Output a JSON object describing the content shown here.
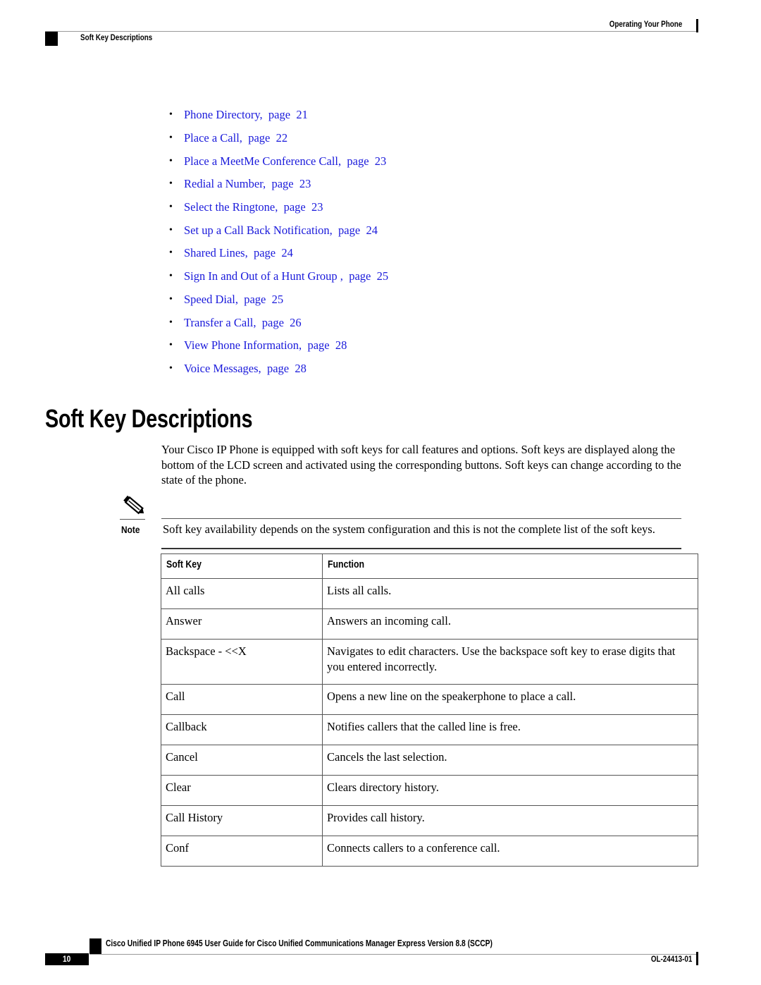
{
  "header": {
    "chapter": "Operating Your Phone",
    "section": "Soft Key Descriptions"
  },
  "toc": [
    {
      "title": "Phone Directory,",
      "page_label": "page",
      "page": "21"
    },
    {
      "title": "Place a Call,",
      "page_label": "page",
      "page": "22"
    },
    {
      "title": "Place a MeetMe Conference Call,",
      "page_label": "page",
      "page": "23"
    },
    {
      "title": "Redial a Number,",
      "page_label": "page",
      "page": "23"
    },
    {
      "title": "Select the Ringtone,",
      "page_label": "page",
      "page": "23"
    },
    {
      "title": "Set up a Call Back Notification,",
      "page_label": "page",
      "page": "24"
    },
    {
      "title": "Shared Lines,",
      "page_label": "page",
      "page": "24"
    },
    {
      "title": "Sign In and Out of a Hunt Group ,",
      "page_label": "page",
      "page": "25"
    },
    {
      "title": "Speed Dial,",
      "page_label": "page",
      "page": "25"
    },
    {
      "title": "Transfer a Call,",
      "page_label": "page",
      "page": "26"
    },
    {
      "title": "View Phone Information,",
      "page_label": "page",
      "page": "28"
    },
    {
      "title": "Voice Messages,",
      "page_label": "page",
      "page": "28"
    }
  ],
  "section": {
    "title": "Soft Key Descriptions",
    "intro": "Your Cisco IP Phone is equipped with soft keys for call features and options. Soft keys are displayed along the bottom of the LCD screen and activated using the corresponding buttons. Soft keys can change according to the state of the phone."
  },
  "note": {
    "label": "Note",
    "icon": "pencil-icon",
    "text": "Soft key availability depends on the system configuration and this is not the complete list of the soft keys."
  },
  "table": {
    "headers": [
      "Soft Key",
      "Function"
    ],
    "rows": [
      {
        "key": "All calls",
        "function": "Lists all calls."
      },
      {
        "key": "Answer",
        "function": "Answers an incoming call."
      },
      {
        "key": "Backspace - <<X",
        "function": "Navigates to edit characters. Use the backspace soft key to erase digits that you entered incorrectly."
      },
      {
        "key": "Call",
        "function": "Opens a new line on the speakerphone to place a call."
      },
      {
        "key": "Callback",
        "function": "Notifies callers that the called line is free."
      },
      {
        "key": "Cancel",
        "function": "Cancels the last selection."
      },
      {
        "key": "Clear",
        "function": "Clears directory history."
      },
      {
        "key": "Call History",
        "function": "Provides call history."
      },
      {
        "key": "Conf",
        "function": "Connects callers to a conference call."
      }
    ]
  },
  "footer": {
    "guide_title": "Cisco Unified IP Phone 6945 User Guide for Cisco Unified Communications Manager Express Version 8.8 (SCCP)",
    "page_number": "10",
    "doc_number": "OL-24413-01"
  }
}
